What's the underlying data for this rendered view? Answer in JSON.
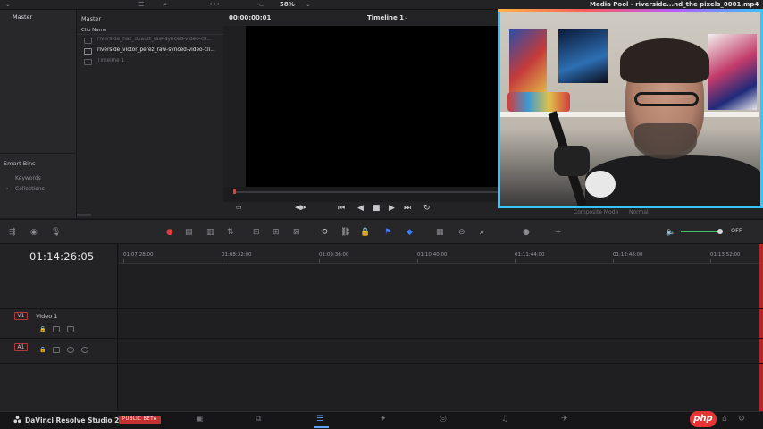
{
  "topbar": {
    "zoom": "58%",
    "window_title": "Media Pool - riverside...nd_the pixels_0001.mp4"
  },
  "sidebar": {
    "master_label": "Master",
    "smart_bins_label": "Smart Bins",
    "items": [
      "Keywords",
      "Collections"
    ]
  },
  "media_pool": {
    "bin_label": "Master",
    "column_header": "Clip Name",
    "clips": [
      {
        "name": "riverside_haz_duault_raw-synced-video-cli..."
      },
      {
        "name": "riverside_victor_perez_raw-synced-video-cli..."
      },
      {
        "name": "Timeline 1"
      }
    ]
  },
  "viewer": {
    "timecode": "00:00:00:01",
    "title": "Timeline 1"
  },
  "right_lower": {
    "labels": [
      "Composite Mode",
      "Normal"
    ]
  },
  "timeline": {
    "timecode": "01:14:26:05",
    "ruler_labels": [
      "01:07:28:00",
      "01:08:32:00",
      "01:09:36:00",
      "01:10:40:00",
      "01:11:44:00",
      "01:12:48:00",
      "01:13:52:00"
    ],
    "volume_label": "OFF",
    "tracks": [
      {
        "id": "V1",
        "name": "Video 1"
      },
      {
        "id": "A1",
        "name": ""
      }
    ]
  },
  "bottombar": {
    "brand": "DaVinci Resolve Studio 20",
    "beta": "PUBLIC BETA"
  },
  "watermark": "php",
  "colors": {
    "accent_blue": "#3e7bff",
    "record_red": "#e43b3b",
    "cam_border": "#33c5ff"
  }
}
